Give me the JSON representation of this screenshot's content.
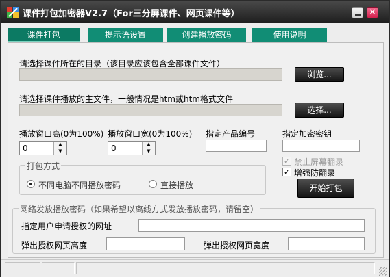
{
  "window": {
    "title": "课件打包加密器V2.7（For三分屏课件、网页课件等）",
    "close_glyph": "✕"
  },
  "tabs": [
    {
      "label": "课件打包"
    },
    {
      "label": "提示语设置"
    },
    {
      "label": "创建播放密码"
    },
    {
      "label": "使用说明"
    }
  ],
  "directory": {
    "label": "请选择课件所在的目录（该目录应该包含全部课件文件）",
    "value": "",
    "browse_label": "浏览..."
  },
  "main_file": {
    "label": "请选择课件播放的主文件，一般情况是htm或htm格式文件",
    "value": "",
    "select_label": "选择..."
  },
  "window_height": {
    "label": "播放窗口高(0为100%)",
    "value": "0"
  },
  "window_width": {
    "label": "播放窗口宽(0为100%)",
    "value": "0"
  },
  "product_id": {
    "label": "指定产品编号",
    "value": ""
  },
  "encrypt_key": {
    "label": "指定加密密钥",
    "value": ""
  },
  "pack_mode": {
    "legend": "打包方式",
    "option_a": "不同电脑不同播放密码",
    "option_b": "直接播放",
    "selected": "option_a"
  },
  "checkboxes": {
    "disable_flip": {
      "label": "禁止屏幕翻录",
      "checked": true,
      "disabled": true
    },
    "enhance_flip": {
      "label": "增强防翻录",
      "checked": true,
      "disabled": false
    }
  },
  "start_button_label": "开始打包",
  "network": {
    "legend": "网络发放播放密码（如果希望以离线方式发放播放密码，请留空）",
    "url_label": "指定用户申请授权的网址",
    "url_value": "",
    "popup_height_label": "弹出授权网页高度",
    "popup_height_value": "",
    "popup_width_label": "弹出授权网页宽度",
    "popup_width_value": ""
  },
  "colors": {
    "tab_bg": "#118d75",
    "titlebar": "#2a2a2a",
    "close_button": "#e0305a"
  }
}
